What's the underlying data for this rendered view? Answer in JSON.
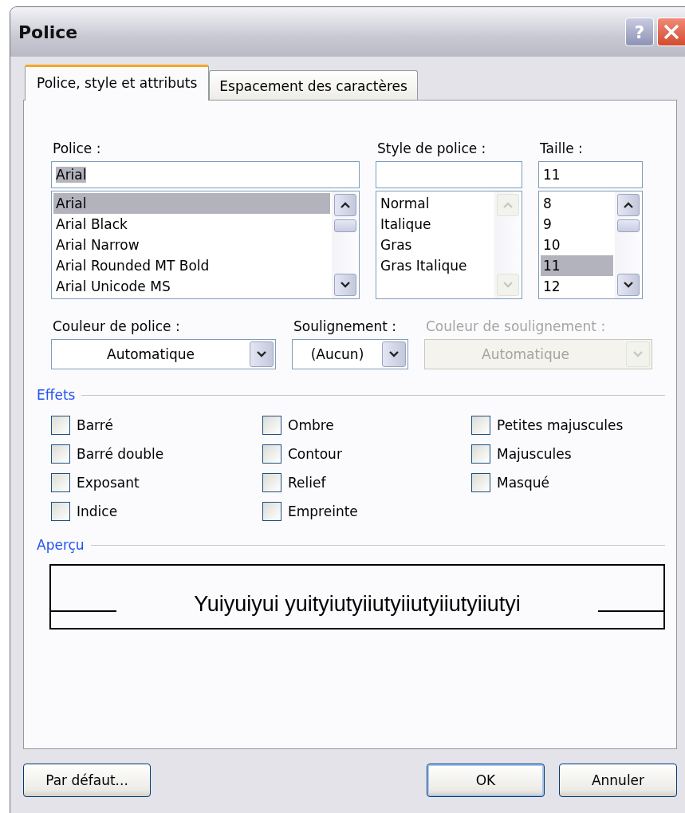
{
  "window": {
    "title": "Police",
    "help_label": "?"
  },
  "tabs": [
    {
      "label": "Police, style et attributs",
      "selected": true
    },
    {
      "label": "Espacement des caractères",
      "selected": false
    }
  ],
  "font_list": {
    "label": "Police :",
    "value": "Arial",
    "text_selected": true,
    "scroll_disabled": false,
    "items": [
      {
        "label": "Arial",
        "selected": true
      },
      {
        "label": "Arial Black",
        "selected": false
      },
      {
        "label": "Arial Narrow",
        "selected": false
      },
      {
        "label": "Arial Rounded MT Bold",
        "selected": false
      },
      {
        "label": "Arial Unicode MS",
        "selected": false
      }
    ]
  },
  "style_list": {
    "label": "Style de police :",
    "scroll_disabled": true,
    "items": [
      {
        "label": "Normal",
        "selected": false
      },
      {
        "label": "Italique",
        "selected": false
      },
      {
        "label": "Gras",
        "selected": false
      },
      {
        "label": "Gras Italique",
        "selected": false
      }
    ]
  },
  "size_list": {
    "label": "Taille :",
    "value": "11",
    "text_selected": false,
    "scroll_disabled": false,
    "items": [
      {
        "label": "8",
        "selected": false
      },
      {
        "label": "9",
        "selected": false
      },
      {
        "label": "10",
        "selected": false
      },
      {
        "label": "11",
        "selected": true
      },
      {
        "label": "12",
        "selected": false
      }
    ]
  },
  "combos": [
    {
      "label": "Couleur de police :",
      "value": "Automatique",
      "disabled": false
    },
    {
      "label": "Soulignement :",
      "value": "(Aucun)",
      "disabled": false
    },
    {
      "label": "Couleur de soulignement :",
      "value": "Automatique",
      "disabled": true
    }
  ],
  "effects": {
    "title": "Effets",
    "columns": [
      [
        {
          "label": "Barré",
          "checked": false
        },
        {
          "label": "Barré double",
          "checked": false
        },
        {
          "label": "Exposant",
          "checked": false
        },
        {
          "label": "Indice",
          "checked": false
        }
      ],
      [
        {
          "label": "Ombre",
          "checked": false
        },
        {
          "label": "Contour",
          "checked": false
        },
        {
          "label": "Relief",
          "checked": false
        },
        {
          "label": "Empreinte",
          "checked": false
        }
      ],
      [
        {
          "label": "Petites majuscules",
          "checked": false
        },
        {
          "label": "Majuscules",
          "checked": false
        },
        {
          "label": "Masqué",
          "checked": false
        }
      ]
    ]
  },
  "preview": {
    "title": "Aperçu",
    "sample": "Yuiyuiyui yuityiutyiiutyiiutyiiutyiiutyi"
  },
  "buttons": [
    {
      "label": "Par défaut...",
      "default": false
    },
    {
      "label": "OK",
      "default": true
    },
    {
      "label": "Annuler",
      "default": false
    }
  ]
}
